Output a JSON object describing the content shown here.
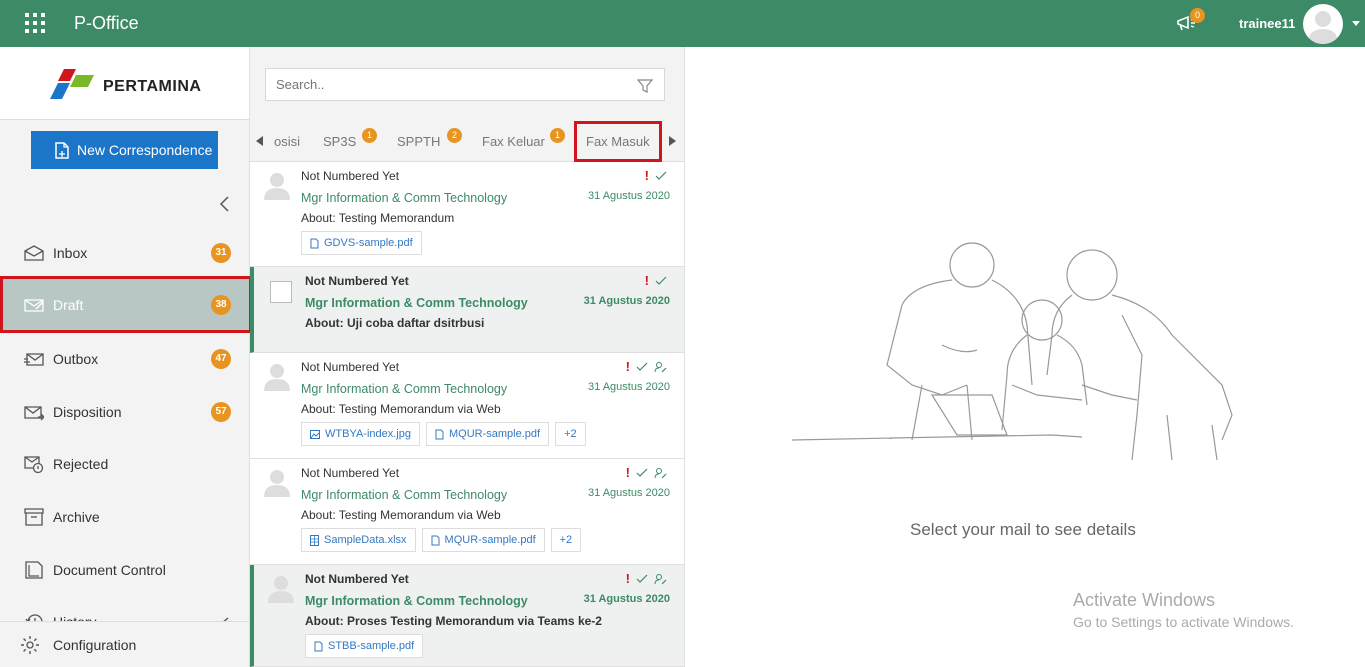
{
  "topbar": {
    "app_title": "P-Office",
    "notification_count": "0",
    "username": "trainee11",
    "color": "#3d8a66"
  },
  "sidebar": {
    "logo_text": "PERTAMINA",
    "new_button": "New Correspondence",
    "items": [
      {
        "label": "Inbox",
        "count": "31",
        "icon": "inbox-icon"
      },
      {
        "label": "Draft",
        "count": "38",
        "icon": "draft-icon"
      },
      {
        "label": "Outbox",
        "count": "47",
        "icon": "outbox-icon"
      },
      {
        "label": "Disposition",
        "count": "57",
        "icon": "disposition-icon"
      },
      {
        "label": "Rejected",
        "icon": "rejected-icon"
      },
      {
        "label": "Archive",
        "icon": "archive-icon"
      },
      {
        "label": "Document Control",
        "icon": "document-control-icon"
      },
      {
        "label": "History",
        "icon": "history-icon"
      }
    ],
    "config_label": "Configuration"
  },
  "search": {
    "placeholder": "Search.."
  },
  "tabs": [
    {
      "label": "osisi"
    },
    {
      "label": "SP3S",
      "count": "1"
    },
    {
      "label": "SPPTH",
      "count": "2"
    },
    {
      "label": "Fax Keluar",
      "count": "1"
    },
    {
      "label": "Fax Masuk"
    }
  ],
  "mails": [
    {
      "number": "Not Numbered Yet",
      "from": "Mgr Information & Comm Technology",
      "about": "About: Testing Memorandum",
      "date": "31 Agustus 2020",
      "attachments": [
        "GDVS-sample.pdf"
      ]
    },
    {
      "number": "Not Numbered Yet",
      "from": "Mgr Information & Comm Technology",
      "about": "About: Uji coba daftar dsitrbusi",
      "date": "31 Agustus 2020",
      "attachments": []
    },
    {
      "number": "Not Numbered Yet",
      "from": "Mgr Information & Comm Technology",
      "about": "About: Testing Memorandum via Web",
      "date": "31 Agustus 2020",
      "attachments": [
        "WTBYA-index.jpg",
        "MQUR-sample.pdf"
      ],
      "more": "+2"
    },
    {
      "number": "Not Numbered Yet",
      "from": "Mgr Information & Comm Technology",
      "about": "About: Testing Memorandum via Web",
      "date": "31 Agustus 2020",
      "attachments": [
        "SampleData.xlsx",
        "MQUR-sample.pdf"
      ],
      "more": "+2"
    },
    {
      "number": "Not Numbered Yet",
      "from": "Mgr Information & Comm Technology",
      "about": "About: Proses Testing Memorandum via Teams ke-2",
      "date": "31 Agustus 2020",
      "attachments": [
        "STBB-sample.pdf"
      ]
    }
  ],
  "detail": {
    "empty_message": "Select your mail to see details"
  },
  "watermark": {
    "line1": "Activate Windows",
    "line2": "Go to Settings to activate Windows."
  }
}
